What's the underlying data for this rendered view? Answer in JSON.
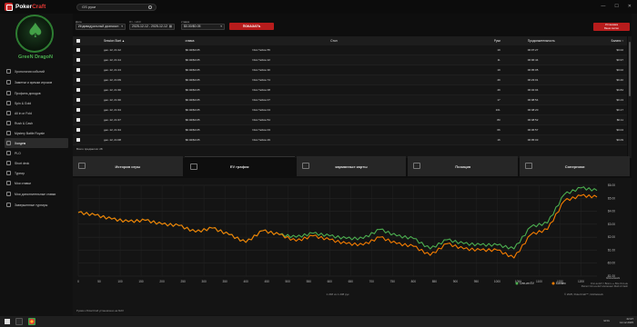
{
  "app": {
    "name_a": "Poker",
    "name_b": "Craft"
  },
  "search": {
    "value": "GS руки"
  },
  "window_buttons": [
    "—",
    "☐",
    "✕"
  ],
  "sidebar": {
    "username": "GreeN DragoN",
    "items": [
      {
        "label": "Хронология событий"
      },
      {
        "label": "Заметки и ярлыки игроков"
      },
      {
        "label": "Профиль доходов"
      },
      {
        "label": "Spin & Gold"
      },
      {
        "label": "All in or Fold"
      },
      {
        "label": "Rush & Cash"
      },
      {
        "label": "Mystery Battle Royale"
      },
      {
        "label": "Холдем"
      },
      {
        "label": "PLO"
      },
      {
        "label": "Short deck"
      },
      {
        "label": "Турнир"
      },
      {
        "label": "Мои ставки"
      },
      {
        "label": "Мои дополнительные ставки"
      },
      {
        "label": "Завершенные турниры"
      }
    ],
    "active_index": 7
  },
  "filters": {
    "type_label": "Дата",
    "type_value": "Индивидуальный диапазон",
    "range_label": "От - Until",
    "range_value": "2025-12-12 - 2025-12-12",
    "stake_label": "ставка",
    "stake_value": "$0.00/$0.05",
    "show_button": "ПОКАЗАТЬ",
    "settings_button_line1": "Установка",
    "settings_button_line2": "Ваши сессии"
  },
  "table": {
    "headers": {
      "date": "Session Start ▲",
      "stake": "ставка",
      "table": "Стол",
      "hands": "Руки",
      "duration": "Продолжительность",
      "balance": "Баланс ↑"
    },
    "rows": [
      {
        "date": "дек. 12, 21:12",
        "stake": "$0.02/$0.05",
        "table": "NLH Yellow 55",
        "hands": "19",
        "duration": "00:07:27",
        "balance": "$0.02"
      },
      {
        "date": "дек. 12, 21:14",
        "stake": "$0.02/$0.05",
        "table": "NLH Yellow 22",
        "hands": "11",
        "duration": "00:06:44",
        "balance": "$0.97"
      },
      {
        "date": "дек. 12, 21:13",
        "stake": "$0.02/$0.05",
        "table": "NLH Yellow 30",
        "hands": "19",
        "duration": "00:05:05",
        "balance": "$0.02"
      },
      {
        "date": "дек. 12, 21:09",
        "stake": "$0.02/$0.05",
        "table": "NLH Yellow 74",
        "hands": "49",
        "duration": "00:23:01",
        "balance": "$0.40"
      },
      {
        "date": "дек. 12, 21:30",
        "stake": "$0.02/$0.05",
        "table": "NLH Yellow 08",
        "hands": "49",
        "duration": "00:32:04",
        "balance": "$0.84"
      },
      {
        "date": "дек. 12, 21:30",
        "stake": "$0.02/$0.05",
        "table": "NLH Yellow 07",
        "hands": "17",
        "duration": "00:08:54",
        "balance": "$0.13"
      },
      {
        "date": "дек. 12, 21:34",
        "stake": "$0.02/$0.05",
        "table": "NLH Yellow 04",
        "hands": "101",
        "duration": "00:48:20",
        "balance": "$0.17"
      },
      {
        "date": "дек. 12, 21:37",
        "stake": "$0.02/$0.05",
        "table": "NLH Yellow 54",
        "hands": "80",
        "duration": "00:48:52",
        "balance": "$0.11"
      },
      {
        "date": "дек. 12, 21:34",
        "stake": "$0.02/$0.05",
        "table": "NLH Yellow 03",
        "hands": "66",
        "duration": "00:36:57",
        "balance": "$0.04"
      },
      {
        "date": "дек. 12, 21:08",
        "stake": "$0.02/$0.05",
        "table": "NLH Yellow 29",
        "hands": "16",
        "duration": "00:05:03",
        "balance": "$0.09"
      }
    ],
    "footer": "Всего предметов: 28"
  },
  "tabs": [
    {
      "label": "История игры",
      "icon": "hand-history-icon"
    },
    {
      "label": "EV график",
      "icon": "ev-graph-icon"
    },
    {
      "label": "карманные карты",
      "icon": "hole-cards-icon"
    },
    {
      "label": "Позиция",
      "icon": "position-icon"
    },
    {
      "label": "Соперники",
      "icon": "opponents-icon"
    }
  ],
  "active_tab": 1,
  "colors": {
    "accent_red": "#b71c1c",
    "ev_line": "#4caf50",
    "balance_line": "#f57c00",
    "active_green": "#2e7d32"
  },
  "chart_data": {
    "type": "line",
    "xlabel": "1 238 из 1 238 рук",
    "ylabel": "",
    "x_ticks": [
      0,
      50,
      100,
      150,
      200,
      250,
      300,
      350,
      400,
      450,
      500,
      550,
      600,
      650,
      700,
      750,
      800,
      850,
      900,
      950,
      1000,
      1050,
      1100,
      1150,
      1200
    ],
    "y_ticks": [
      "-$1.00",
      "-$0.00",
      "$1.00",
      "$2.00",
      "$3.00",
      "$4.00",
      "$5.00",
      "$6.00"
    ],
    "ylim": [
      -1.0,
      6.0
    ],
    "xlim": [
      0,
      1238
    ],
    "legend": [
      "Олл-ин EV",
      "Баланс"
    ],
    "series": [
      {
        "name": "Олл-ин EV",
        "x": [
          0,
          40,
          80,
          120,
          160,
          200,
          240,
          280,
          320,
          360,
          400,
          440,
          480,
          520,
          560,
          600,
          640,
          680,
          720,
          760,
          800,
          840,
          880,
          920,
          960,
          1000,
          1040,
          1080,
          1120,
          1160,
          1200,
          1238
        ],
        "values": [
          3.9,
          3.7,
          3.4,
          3.2,
          3.3,
          3.0,
          2.9,
          2.4,
          2.7,
          2.2,
          1.6,
          2.5,
          2.2,
          2.0,
          2.3,
          2.1,
          1.9,
          1.9,
          2.6,
          2.1,
          1.9,
          1.1,
          1.8,
          1.5,
          1.4,
          1.4,
          1.1,
          2.8,
          3.1,
          5.3,
          5.8,
          5.6
        ]
      },
      {
        "name": "Баланс",
        "x": [
          0,
          40,
          80,
          120,
          160,
          200,
          240,
          280,
          320,
          360,
          400,
          440,
          480,
          520,
          560,
          600,
          640,
          680,
          720,
          760,
          800,
          840,
          880,
          920,
          960,
          1000,
          1040,
          1080,
          1120,
          1160,
          1200,
          1238
        ],
        "values": [
          3.9,
          3.7,
          3.4,
          3.2,
          3.3,
          3.0,
          2.9,
          2.4,
          2.7,
          2.2,
          1.6,
          2.5,
          2.2,
          1.7,
          2.1,
          1.8,
          1.5,
          1.4,
          2.0,
          1.5,
          1.3,
          0.6,
          1.5,
          1.1,
          1.0,
          1.0,
          0.4,
          2.2,
          2.6,
          4.8,
          5.2,
          5.1
        ]
      }
    ]
  },
  "chart_footer": {
    "line1": "Олл-ин EV = Всего ++ Все Олл-ин",
    "line2": "Расчет Олл-ин EV исключает Rush & Cash",
    "copyright": "© 2025, PokerCraft™, GGNetwork",
    "brand": "GGnetwork"
  },
  "status": {
    "text": "Рукам к PokerCraft установлено на MAX"
  },
  "taskbar": {
    "lang": "ENG",
    "time": "22:27",
    "date": "12.12.2025"
  }
}
